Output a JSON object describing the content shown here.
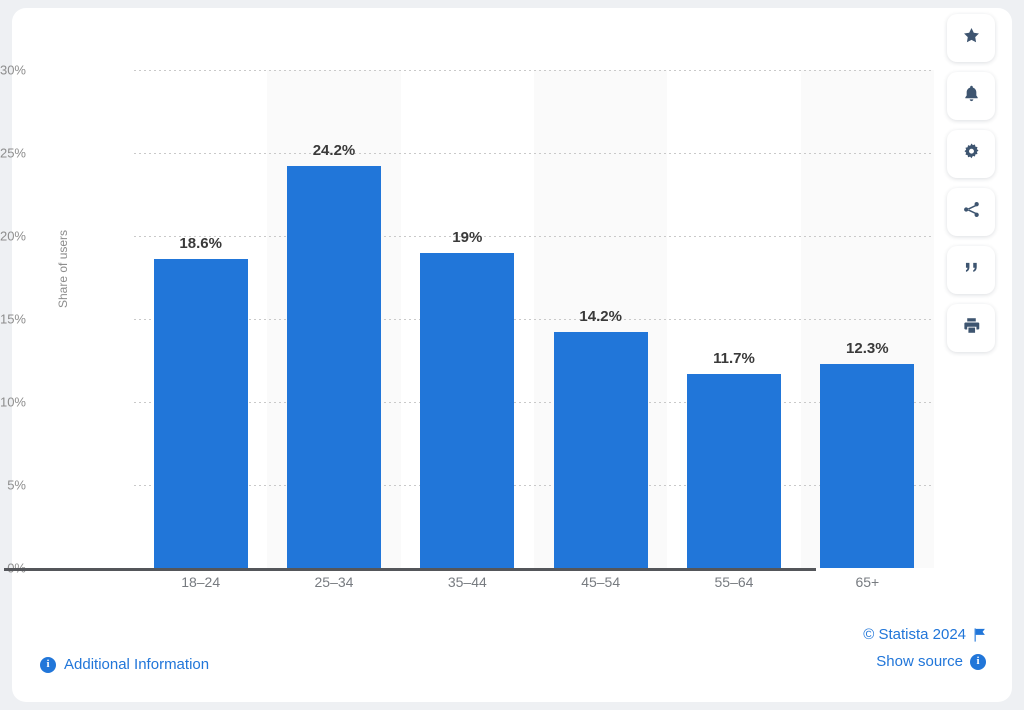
{
  "chart_data": {
    "type": "bar",
    "title": "",
    "subtitle": "",
    "xlabel": "",
    "ylabel": "Share of users",
    "categories": [
      "18–24",
      "25–34",
      "35–44",
      "45–54",
      "55–64",
      "65+"
    ],
    "values": [
      18.6,
      24.2,
      19,
      14.2,
      11.7,
      12.3
    ],
    "value_labels": [
      "18.6%",
      "24.2%",
      "19%",
      "14.2%",
      "11.7%",
      "12.3%"
    ],
    "ylim": [
      0,
      30
    ],
    "yticks": [
      0,
      5,
      10,
      15,
      20,
      25,
      30
    ],
    "ytick_labels": [
      "0%",
      "5%",
      "10%",
      "15%",
      "20%",
      "25%",
      "30%"
    ],
    "grid": true,
    "legend": false,
    "bar_color": "#2176d9",
    "band_color": "#fafafa",
    "axis_color": "#54565a",
    "gridline_color": "#c9c9c9",
    "series": [
      {
        "name": "Share of users",
        "values": [
          18.6,
          24.2,
          19,
          14.2,
          11.7,
          12.3
        ]
      }
    ]
  },
  "toolbar": {
    "buttons": [
      {
        "name": "star-icon",
        "tooltip": "Favorite"
      },
      {
        "name": "bell-icon",
        "tooltip": "Notifications"
      },
      {
        "name": "gear-icon",
        "tooltip": "Settings"
      },
      {
        "name": "share-icon",
        "tooltip": "Share"
      },
      {
        "name": "quote-icon",
        "tooltip": "Cite"
      },
      {
        "name": "print-icon",
        "tooltip": "Print"
      }
    ]
  },
  "footer": {
    "additional_information": "Additional Information",
    "copyright": "© Statista 2024",
    "show_source": "Show source",
    "info_glyph": "i",
    "link_color": "#2176d9"
  }
}
